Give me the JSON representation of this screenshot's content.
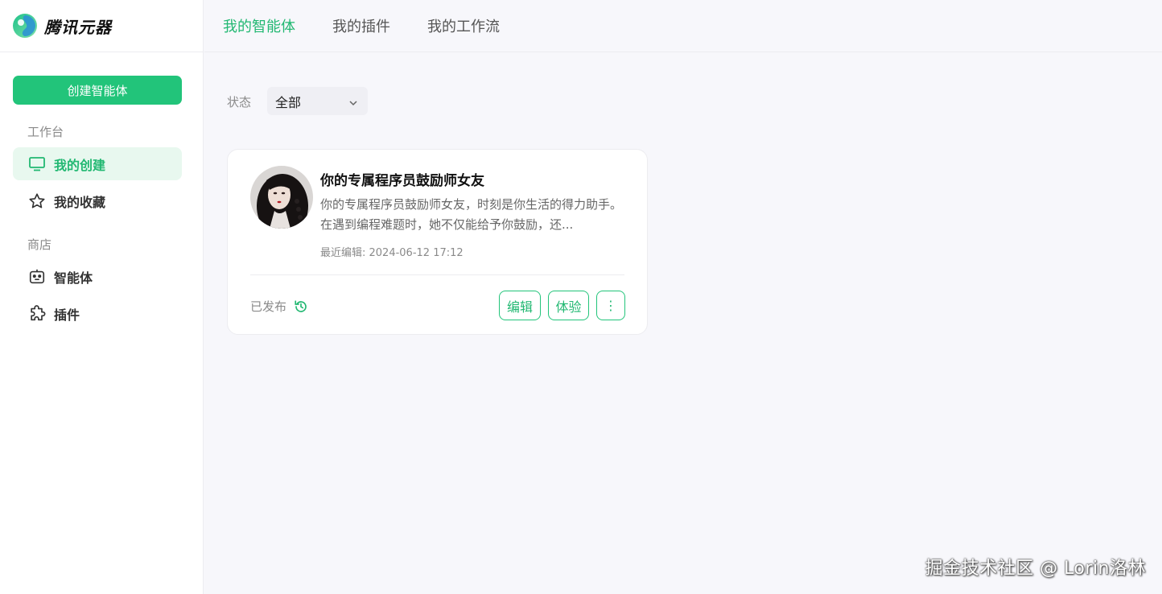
{
  "brand": {
    "name": "腾讯元器",
    "accent": "#22c47a"
  },
  "sidebar": {
    "create_label": "创建智能体",
    "sections": [
      {
        "label": "工作台",
        "items": [
          {
            "label": "我的创建",
            "icon": "monitor-icon",
            "active": true
          },
          {
            "label": "我的收藏",
            "icon": "star-icon",
            "active": false
          }
        ]
      },
      {
        "label": "商店",
        "items": [
          {
            "label": "智能体",
            "icon": "robot-icon",
            "active": false
          },
          {
            "label": "插件",
            "icon": "puzzle-icon",
            "active": false
          }
        ]
      }
    ]
  },
  "top_tabs": [
    {
      "label": "我的智能体",
      "active": true
    },
    {
      "label": "我的插件",
      "active": false
    },
    {
      "label": "我的工作流",
      "active": false
    }
  ],
  "filter": {
    "label": "状态",
    "value": "全部"
  },
  "agents": [
    {
      "title": "你的专属程序员鼓励师女友",
      "description": "你的专属程序员鼓励师女友，时刻是你生活的得力助手。在遇到编程难题时，她不仅能给予你鼓励，还...",
      "last_edit": "最近编辑: 2024-06-12 17:12",
      "status": "已发布",
      "actions": {
        "edit": "编辑",
        "try": "体验",
        "more": "⋮"
      }
    }
  ],
  "watermark": "掘金技术社区 @ Lorin洛林"
}
